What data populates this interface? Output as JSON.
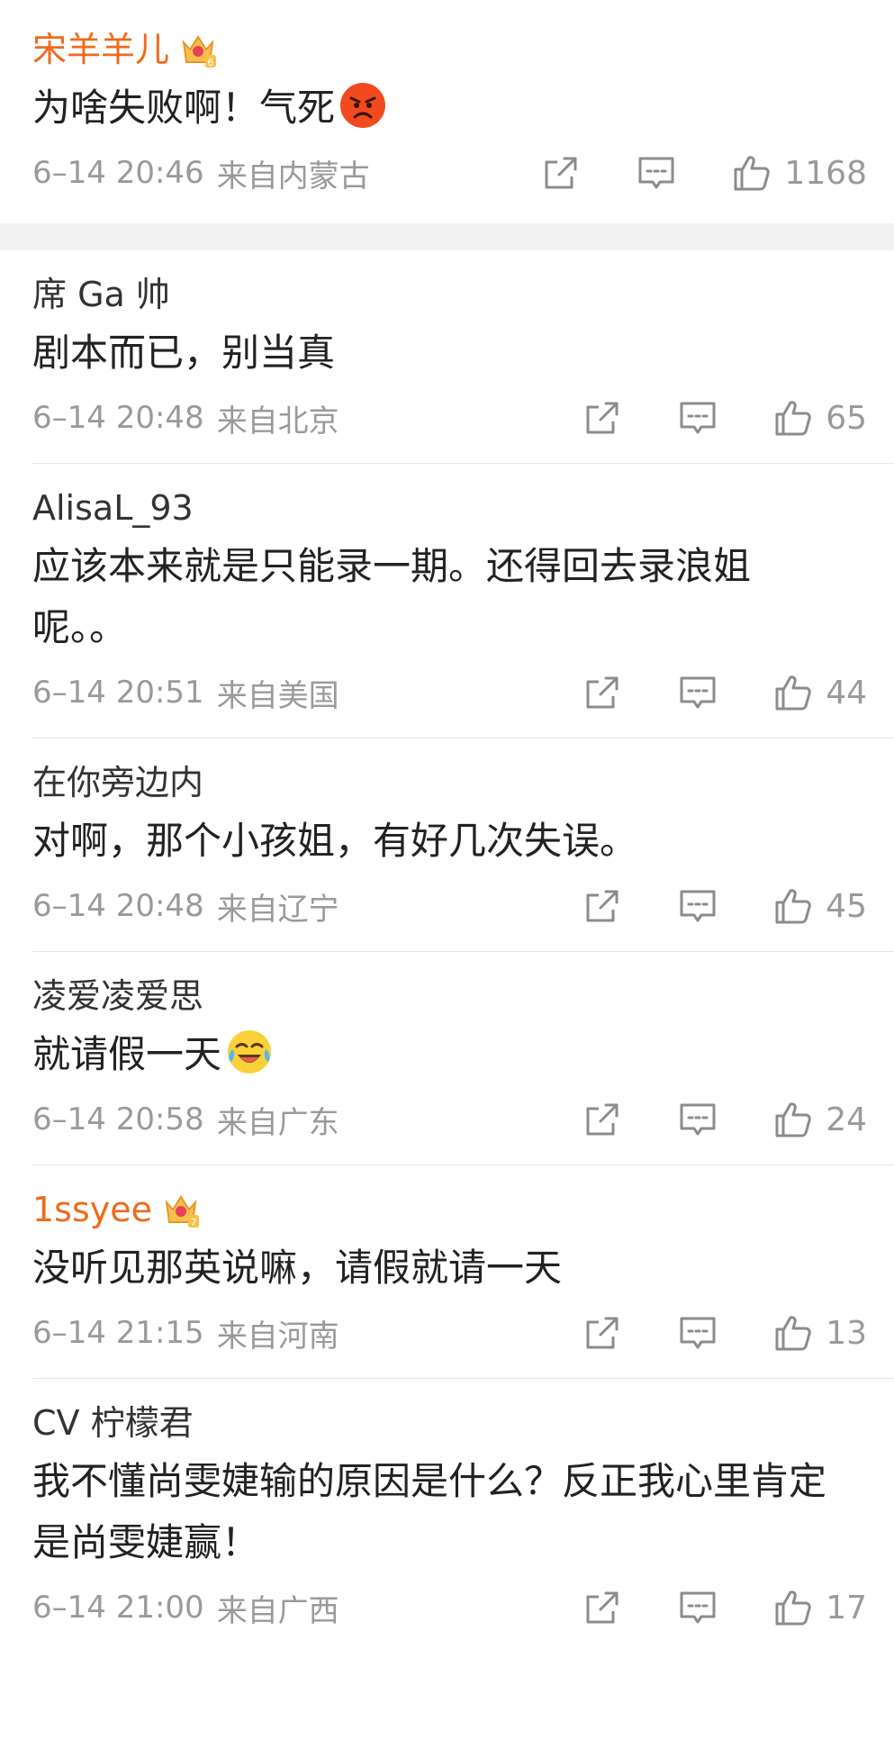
{
  "colors": {
    "vip_name": "#f06a1a",
    "meta_text": "#9a9a9a",
    "divider": "#e6e6e6",
    "section_gap": "#f2f2f2"
  },
  "comments": [
    {
      "username": "宋羊羊儿",
      "vip": true,
      "badge": "crown-level-6",
      "text": "为啥失败啊！气死",
      "emoji": "angry-face",
      "time": "6–14 20:46",
      "location": "来自内蒙古",
      "likes": "1168"
    },
    {
      "username": "席 Ga 帅",
      "vip": false,
      "text": "剧本而已，别当真",
      "time": "6–14 20:48",
      "location": "来自北京",
      "likes": "65"
    },
    {
      "username": "AlisaL_93",
      "vip": false,
      "text": "应该本来就是只能录一期。还得回去录浪姐呢。。",
      "time": "6–14 20:51",
      "location": "来自美国",
      "likes": "44"
    },
    {
      "username": "在你旁边内",
      "vip": false,
      "text": "对啊，那个小孩姐，有好几次失误。",
      "time": "6–14 20:48",
      "location": "来自辽宁",
      "likes": "45"
    },
    {
      "username": "凌爱凌爱思",
      "vip": false,
      "text": "就请假一天",
      "emoji": "laughing-crying-face",
      "time": "6–14 20:58",
      "location": "来自广东",
      "likes": "24"
    },
    {
      "username": "1ssyee",
      "vip": true,
      "badge": "crown-level-7",
      "text": "没听见那英说嘛，请假就请一天",
      "time": "6–14 21:15",
      "location": "来自河南",
      "likes": "13"
    },
    {
      "username": "CV 柠檬君",
      "vip": false,
      "text": "我不懂尚雯婕输的原因是什么？反正我心里肯定是尚雯婕赢！",
      "time": "6–14 21:00",
      "location": "来自广西",
      "likes": "17"
    }
  ]
}
